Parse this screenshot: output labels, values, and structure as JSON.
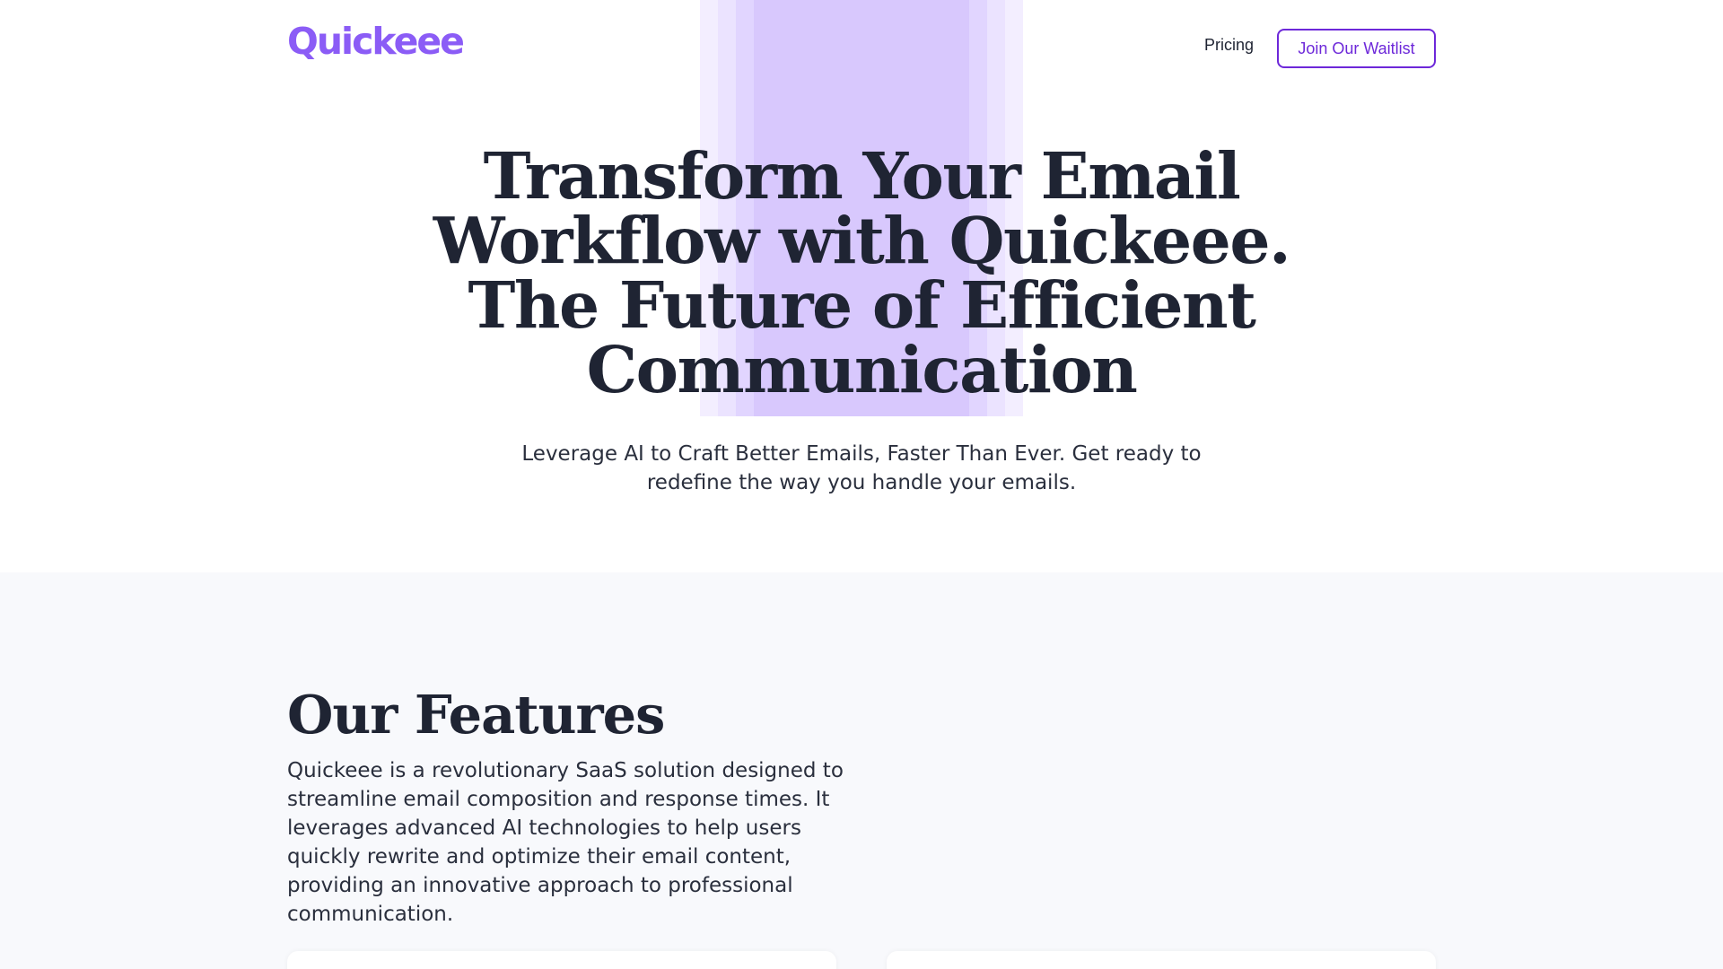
{
  "brand": {
    "logo_text": "Quickeee",
    "accent_color": "#8b5cf6",
    "button_color": "#6d28d9"
  },
  "nav": {
    "pricing_label": "Pricing",
    "waitlist_label": "Join Our Waitlist"
  },
  "hero": {
    "title_lines": [
      "Transform Your Email",
      "Workflow with Quickeee.",
      "The Future of Efficient",
      "Communication"
    ],
    "subtitle": "Leverage AI to Craft Better Emails, Faster Than Ever. Get ready to redefine the way you handle your emails."
  },
  "features": {
    "title": "Our Features",
    "description": "Quickeee is a revolutionary SaaS solution designed to streamline email composition and response times. It leverages advanced AI technologies to help users quickly rewrite and optimize their email content, providing an innovative approach to professional communication."
  }
}
